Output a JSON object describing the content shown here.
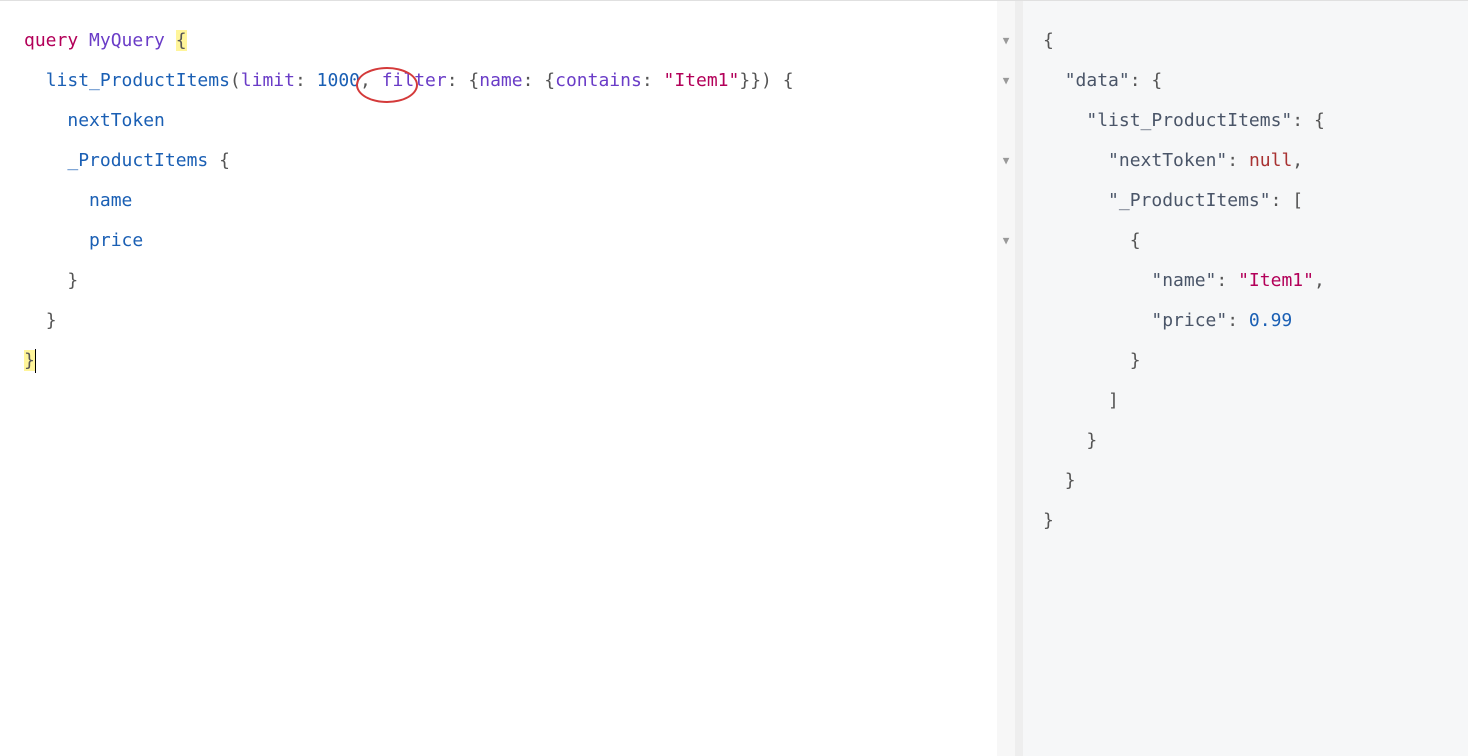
{
  "query": {
    "keyword": "query",
    "operationName": "MyQuery",
    "fieldName": "list_ProductItems",
    "arg1Name": "limit",
    "arg1Value": "1000",
    "arg2Name": "filter",
    "filterKey": "name",
    "filterOp": "contains",
    "filterValue": "\"Item1\"",
    "sub1": "nextToken",
    "sub2": "_ProductItems",
    "leaf1": "name",
    "leaf2": "price"
  },
  "response": {
    "key_data": "\"data\"",
    "key_list": "\"list_ProductItems\"",
    "key_next": "\"nextToken\"",
    "val_next": "null",
    "key_items": "\"_ProductItems\"",
    "key_name": "\"name\"",
    "val_name": "\"Item1\"",
    "key_price": "\"price\"",
    "val_price": "0.99"
  },
  "fold": {
    "a1": "▼",
    "a2": "▼",
    "a3": "▼",
    "a4": "▼"
  }
}
